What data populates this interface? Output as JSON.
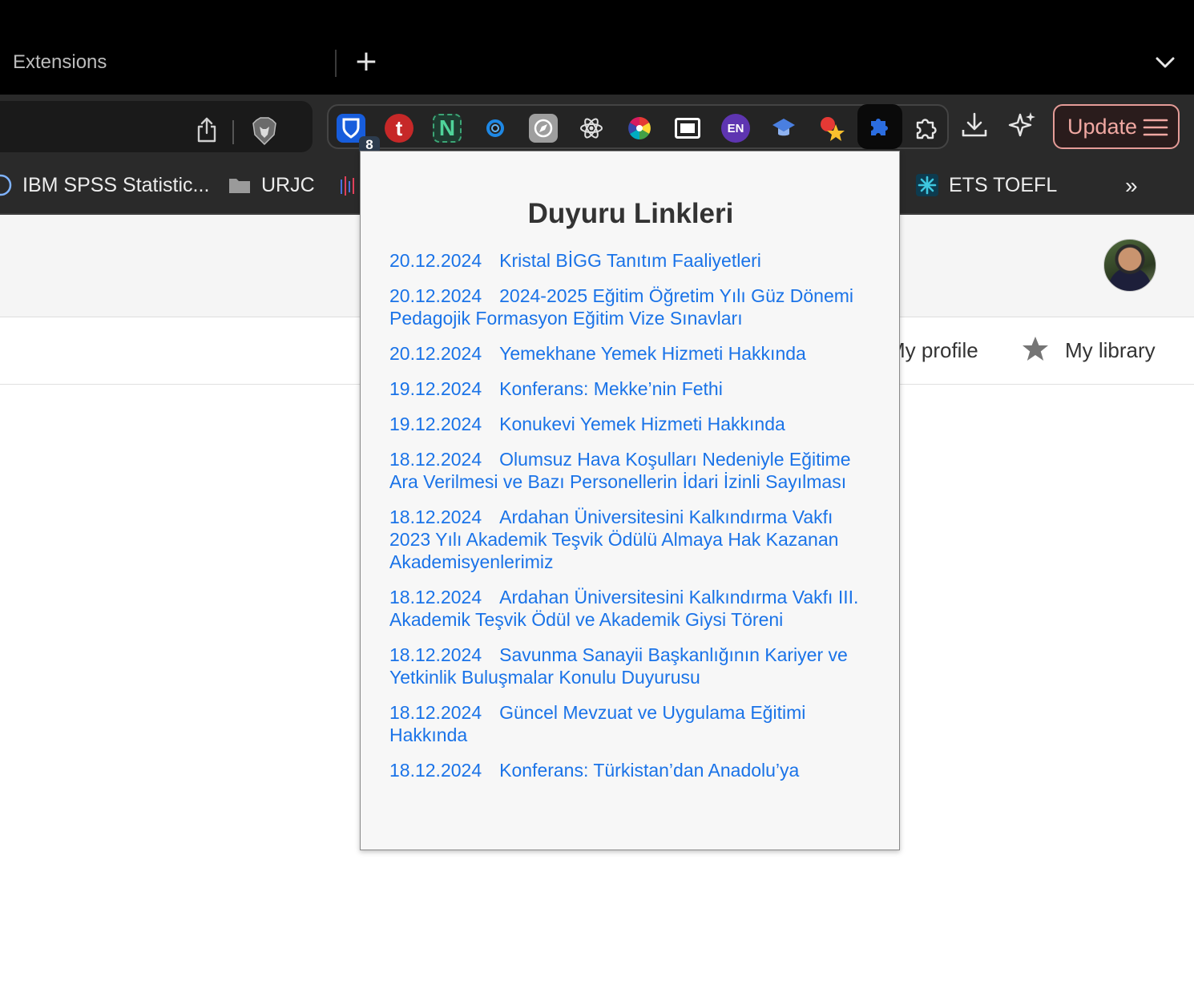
{
  "tab": {
    "title": "Extensions",
    "new_tab": "+"
  },
  "toolbar": {
    "extensions": [
      {
        "name": "bitwarden-extension-icon",
        "color": "#175ddc",
        "glyph": "",
        "badge": "8"
      },
      {
        "name": "t-extension-icon",
        "color": "#c62828",
        "glyph": "t"
      },
      {
        "name": "notion-n-extension-icon",
        "color": "#2e7d5b",
        "glyph": "N"
      },
      {
        "name": "circle-extension-icon",
        "color": "#1e88e5",
        "glyph": ""
      },
      {
        "name": "compass-extension-icon",
        "color": "#9e9e9e",
        "glyph": ""
      },
      {
        "name": "react-devtools-icon",
        "color": "#e0e0e0",
        "glyph": ""
      },
      {
        "name": "color-wheel-extension-icon",
        "color": "#e53935",
        "glyph": ""
      },
      {
        "name": "picture-in-picture-icon",
        "color": "#ffffff",
        "glyph": ""
      },
      {
        "name": "language-en-extension-icon",
        "color": "#5e35b1",
        "glyph": "EN"
      },
      {
        "name": "graduation-cap-extension-icon",
        "color": "#4a7fe0",
        "glyph": ""
      },
      {
        "name": "star-extension-icon",
        "color": "#fbc02d",
        "glyph": ""
      },
      {
        "name": "puzzle-extension-active-icon",
        "color": "#2b6de0",
        "glyph": ""
      }
    ],
    "update_label": "Update"
  },
  "bookmarks": {
    "items": [
      {
        "label": "IBM SPSS Statistic..."
      },
      {
        "label": "URJC"
      },
      {
        "label": "ETS TOEFL"
      }
    ],
    "more": "»"
  },
  "page": {
    "nav": {
      "profile": "My profile",
      "library": "My library"
    }
  },
  "popup": {
    "title": "Duyuru Linkleri",
    "announcements": [
      {
        "date": "20.12.2024",
        "title": "Kristal BİGG Tanıtım Faaliyetleri"
      },
      {
        "date": "20.12.2024",
        "title": "2024-2025 Eğitim Öğretim Yılı Güz Dönemi Pedagojik Formasyon Eğitim Vize Sınavları"
      },
      {
        "date": "20.12.2024",
        "title": "Yemekhane Yemek Hizmeti Hakkında"
      },
      {
        "date": "19.12.2024",
        "title": "Konferans: Mekke’nin Fethi"
      },
      {
        "date": "19.12.2024",
        "title": "Konukevi Yemek Hizmeti Hakkında"
      },
      {
        "date": "18.12.2024",
        "title": "Olumsuz Hava Koşulları Nedeniyle Eğitime Ara Verilmesi ve Bazı Personellerin İdari İzinli Sayılması"
      },
      {
        "date": "18.12.2024",
        "title": "Ardahan Üniversitesini Kalkındırma Vakfı 2023 Yılı Akademik Teşvik Ödülü Almaya Hak Kazanan Akademisyenlerimiz"
      },
      {
        "date": "18.12.2024",
        "title": "Ardahan Üniversitesini Kalkındırma Vakfı III. Akademik Teşvik Ödül ve Akademik Giysi Töreni"
      },
      {
        "date": "18.12.2024",
        "title": "Savunma Sanayii Başkanlığının Kariyer ve Yetkinlik Buluşmalar Konulu Duyurusu"
      },
      {
        "date": "18.12.2024",
        "title": "Güncel Mevzuat ve Uygulama Eğitimi Hakkında"
      },
      {
        "date": "18.12.2024",
        "title": "Konferans: Türkistan’dan Anadolu’ya"
      }
    ]
  }
}
